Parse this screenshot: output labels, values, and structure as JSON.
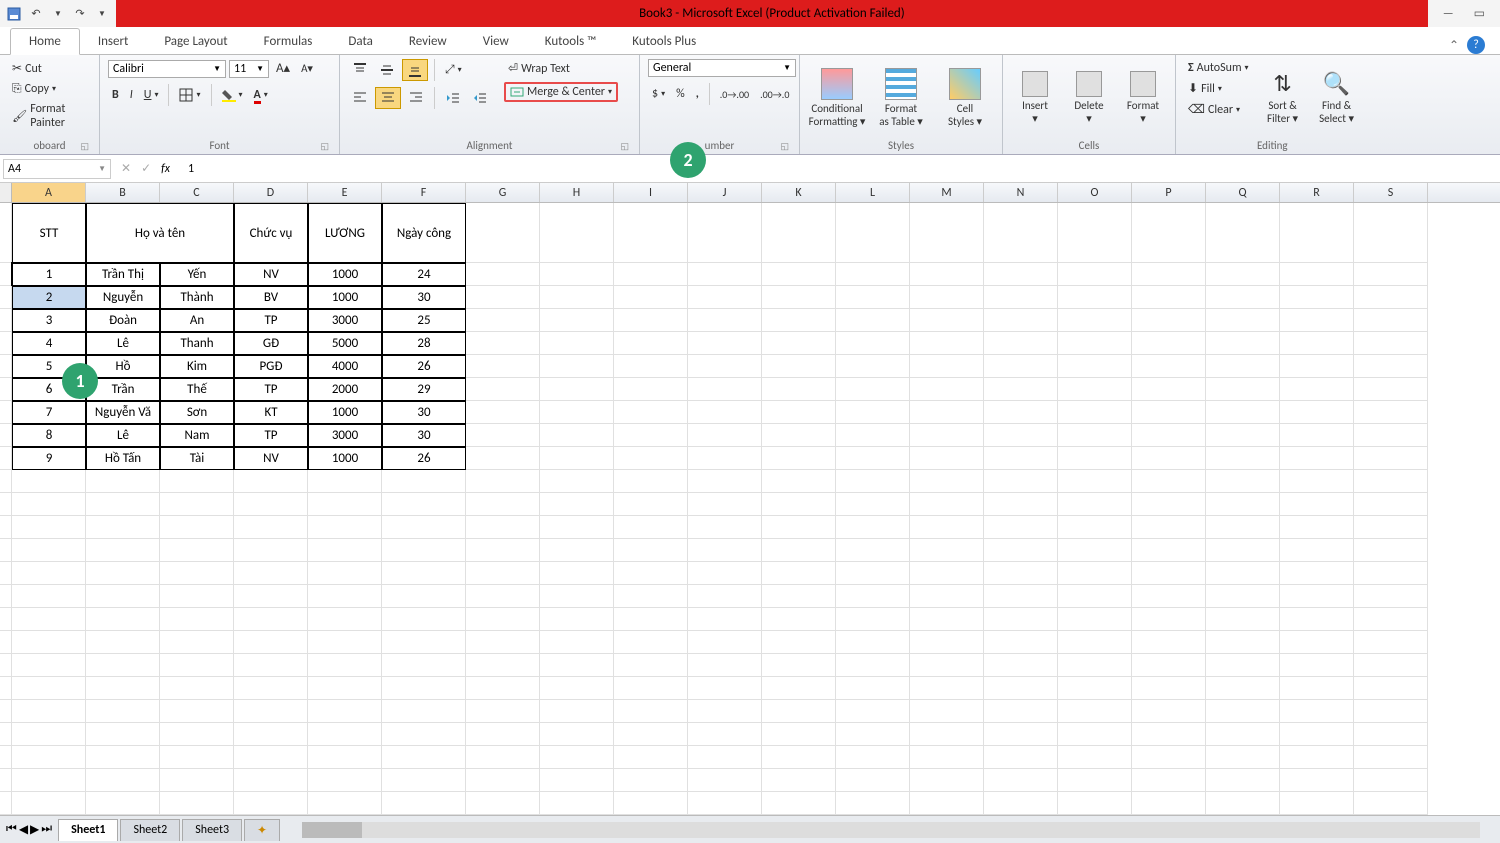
{
  "title": "Book3 - Microsoft Excel (Product Activation Failed)",
  "qat": {
    "save": "💾",
    "undo": "↶",
    "redo": "↷"
  },
  "tabs": [
    "Home",
    "Insert",
    "Page Layout",
    "Formulas",
    "Data",
    "Review",
    "View",
    "Kutools ™",
    "Kutools Plus"
  ],
  "active_tab": "Home",
  "ribbon": {
    "clipboard": {
      "cut": "Cut",
      "copy": "Copy",
      "painter": "Format Painter",
      "label": "Clipboard"
    },
    "font": {
      "name": "Calibri",
      "size": "11",
      "label": "Font"
    },
    "alignment": {
      "wrap": "Wrap Text",
      "merge": "Merge & Center",
      "label": "Alignment"
    },
    "number": {
      "format": "General",
      "label": "Number"
    },
    "styles": {
      "cond": "Conditional Formatting",
      "tbl": "Format as Table",
      "cell": "Cell Styles",
      "label": "Styles"
    },
    "cells": {
      "insert": "Insert",
      "delete": "Delete",
      "format": "Format",
      "label": "Cells"
    },
    "editing": {
      "sum": "AutoSum",
      "fill": "Fill",
      "clear": "Clear",
      "sort": "Sort & Filter",
      "find": "Find & Select",
      "label": "Editing"
    }
  },
  "name_box": "A4",
  "formula": "1",
  "columns": [
    "A",
    "B",
    "C",
    "D",
    "E",
    "F",
    "G",
    "H",
    "I",
    "J",
    "K",
    "L",
    "M",
    "N",
    "O",
    "P",
    "Q",
    "R",
    "S"
  ],
  "headers": {
    "stt": "STT",
    "hoten": "Họ và tên",
    "chucvu": "Chức vụ",
    "luong": "LƯƠNG",
    "ngaycong": "Ngày công"
  },
  "rows": [
    {
      "stt": "1",
      "ho": "Trần Thị",
      "ten": "Yến",
      "cv": "NV",
      "luong": "1000",
      "nc": "24"
    },
    {
      "stt": "2",
      "ho": "Nguyễn",
      "ten": "Thành",
      "cv": "BV",
      "luong": "1000",
      "nc": "30"
    },
    {
      "stt": "3",
      "ho": "Đoàn",
      "ten": "An",
      "cv": "TP",
      "luong": "3000",
      "nc": "25"
    },
    {
      "stt": "4",
      "ho": "Lê",
      "ten": "Thanh",
      "cv": "GĐ",
      "luong": "5000",
      "nc": "28"
    },
    {
      "stt": "5",
      "ho": "Hồ",
      "ten": "Kim",
      "cv": "PGĐ",
      "luong": "4000",
      "nc": "26"
    },
    {
      "stt": "6",
      "ho": "Trần",
      "ten": "Thế",
      "cv": "TP",
      "luong": "2000",
      "nc": "29"
    },
    {
      "stt": "7",
      "ho": "Nguyễn Vă",
      "ten": "Sơn",
      "cv": "KT",
      "luong": "1000",
      "nc": "30"
    },
    {
      "stt": "8",
      "ho": "Lê",
      "ten": "Nam",
      "cv": "TP",
      "luong": "3000",
      "nc": "30"
    },
    {
      "stt": "9",
      "ho": "Hồ Tấn",
      "ten": "Tài",
      "cv": "NV",
      "luong": "1000",
      "nc": "26"
    }
  ],
  "sheets": [
    "Sheet1",
    "Sheet2",
    "Sheet3"
  ],
  "active_sheet": "Sheet1",
  "anno": {
    "one": "1",
    "two": "2"
  }
}
